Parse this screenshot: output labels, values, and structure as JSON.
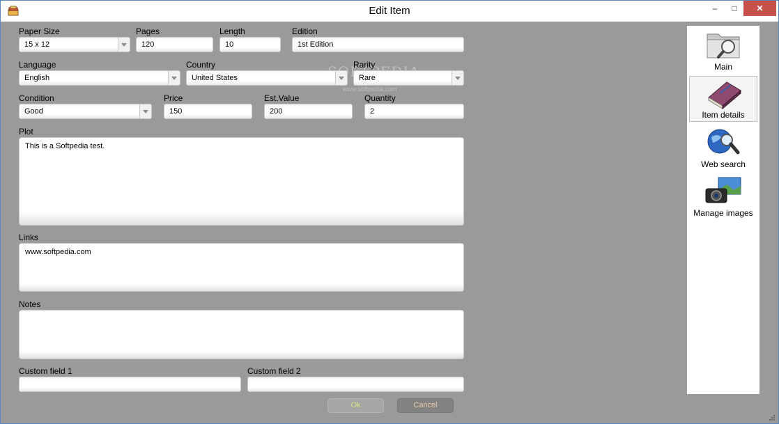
{
  "window": {
    "title": "Edit Item"
  },
  "titlebar_buttons": {
    "minimize": "–",
    "maximize": "□",
    "close": "✕"
  },
  "fields": {
    "paper_size": {
      "label": "Paper Size",
      "value": "15 x 12"
    },
    "pages": {
      "label": "Pages",
      "value": "120"
    },
    "length": {
      "label": "Length",
      "value": "10"
    },
    "edition": {
      "label": "Edition",
      "value": "1st Edition"
    },
    "language": {
      "label": "Language",
      "value": "English"
    },
    "country": {
      "label": "Country",
      "value": "United States"
    },
    "rarity": {
      "label": "Rarity",
      "value": "Rare"
    },
    "condition": {
      "label": "Condition",
      "value": "Good"
    },
    "price": {
      "label": "Price",
      "value": "150"
    },
    "est_value": {
      "label": "Est.Value",
      "value": "200"
    },
    "quantity": {
      "label": "Quantity",
      "value": "2"
    },
    "plot": {
      "label": "Plot",
      "value": "This is a Softpedia test."
    },
    "links": {
      "label": "Links",
      "value": "www.softpedia.com"
    },
    "notes": {
      "label": "Notes",
      "value": ""
    },
    "custom1": {
      "label": "Custom field 1",
      "value": ""
    },
    "custom2": {
      "label": "Custom field 2",
      "value": ""
    }
  },
  "nav": [
    {
      "label": "Main",
      "icon": "folder-search-icon"
    },
    {
      "label": "Item details",
      "icon": "book-icon",
      "selected": true
    },
    {
      "label": "Web search",
      "icon": "globe-search-icon"
    },
    {
      "label": "Manage images",
      "icon": "camera-images-icon"
    }
  ],
  "buttons": {
    "ok": "Ok",
    "cancel": "Cancel"
  },
  "watermark": {
    "text": "SOFTPEDIA",
    "sub": "www.softpedia.com"
  },
  "colors": {
    "background": "#9a9a9a",
    "close_button": "#c7504b",
    "ok_text": "#d8e08a",
    "cancel_text": "#e8c9a8"
  }
}
